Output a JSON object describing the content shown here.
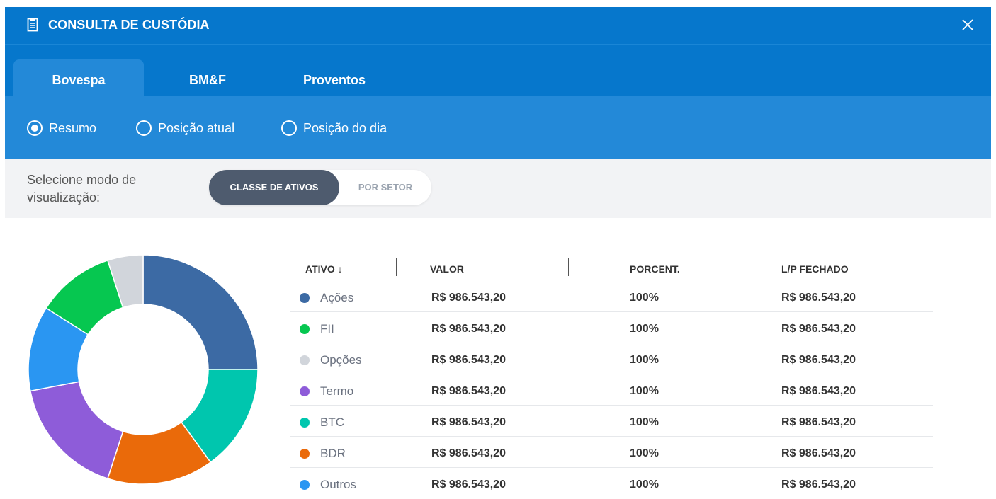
{
  "window": {
    "title": "CONSULTA DE CUSTÓDIA"
  },
  "tabs": [
    {
      "label": "Bovespa",
      "active": true
    },
    {
      "label": "BM&F",
      "active": false
    },
    {
      "label": "Proventos",
      "active": false
    }
  ],
  "radios": [
    {
      "label": "Resumo",
      "checked": true
    },
    {
      "label": "Posição atual",
      "checked": false
    },
    {
      "label": "Posição do dia",
      "checked": false
    }
  ],
  "mode": {
    "label_line1": "Selecione modo de",
    "label_line2": "visualização:",
    "options": [
      "CLASSE DE ATIVOS",
      "POR SETOR"
    ],
    "selected": "CLASSE DE ATIVOS"
  },
  "table": {
    "headers": [
      "ATIVO ↓",
      "VALOR",
      "PORCENT.",
      "L/P FECHADO"
    ],
    "rows": [
      {
        "ativo": "Ações",
        "valor": "R$ 986.543,20",
        "porcent": "100%",
        "lp": "R$ 986.543,20",
        "color": "#3c6aa4"
      },
      {
        "ativo": "FII",
        "valor": "R$ 986.543,20",
        "porcent": "100%",
        "lp": "R$ 986.543,20",
        "color": "#06c750"
      },
      {
        "ativo": "Opções",
        "valor": "R$ 986.543,20",
        "porcent": "100%",
        "lp": "R$ 986.543,20",
        "color": "#d1d5db"
      },
      {
        "ativo": "Termo",
        "valor": "R$ 986.543,20",
        "porcent": "100%",
        "lp": "R$ 986.543,20",
        "color": "#8e5cd9"
      },
      {
        "ativo": "BTC",
        "valor": "R$ 986.543,20",
        "porcent": "100%",
        "lp": "R$ 986.543,20",
        "color": "#00c6ae"
      },
      {
        "ativo": "BDR",
        "valor": "R$ 986.543,20",
        "porcent": "100%",
        "lp": "R$ 986.543,20",
        "color": "#ea6a0a"
      },
      {
        "ativo": "Outros",
        "valor": "R$ 986.543,20",
        "porcent": "100%",
        "lp": "R$ 986.543,20",
        "color": "#2a96f2"
      }
    ]
  },
  "chart_data": {
    "type": "pie",
    "categories": [
      "Ações",
      "BTC",
      "BDR",
      "Termo",
      "Outros",
      "FII",
      "Opções"
    ],
    "values": [
      25,
      15,
      15,
      17,
      12,
      11,
      5
    ],
    "colors": [
      "#3c6aa4",
      "#00c6ae",
      "#ea6a0a",
      "#8e5cd9",
      "#2a96f2",
      "#06c750",
      "#d1d5db"
    ]
  },
  "colors": {
    "titlebar": "#0677cc",
    "radiobar": "#2389d8",
    "modebar": "#f2f3f5",
    "toggle_active": "#4e5b6e"
  }
}
